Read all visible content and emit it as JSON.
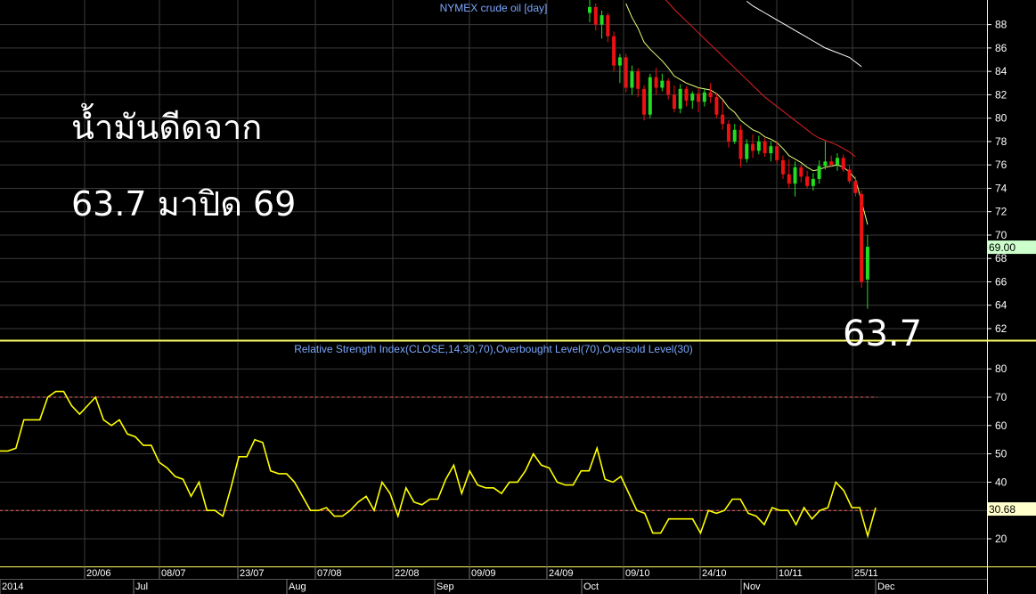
{
  "annotations": {
    "line1": "น้ำมันดีดจาก",
    "line2": "63.7 มาปิด 69",
    "low_label": "63.7"
  },
  "chart_data": [
    {
      "type": "candlestick",
      "title": "NYMEX crude oil [day]",
      "ylim": [
        61,
        90
      ],
      "y_ticks": [
        "62",
        "64",
        "66",
        "68",
        "70",
        "72",
        "74",
        "76",
        "78",
        "80",
        "82",
        "84",
        "86",
        "88"
      ],
      "last_value_label": "69.00",
      "last_value": 69.0,
      "series": [
        {
          "kind": "ohlc",
          "points": [
            [
              89.0,
              90.5,
              88.2,
              89.5
            ],
            [
              89.5,
              89.8,
              87.5,
              88.0
            ],
            [
              88.0,
              89.2,
              86.8,
              88.8
            ],
            [
              88.8,
              89.0,
              86.5,
              87.0
            ],
            [
              87.0,
              87.4,
              84.0,
              84.5
            ],
            [
              84.5,
              85.5,
              83.0,
              85.2
            ],
            [
              85.2,
              85.5,
              82.2,
              82.6
            ],
            [
              82.6,
              84.5,
              82.0,
              84.0
            ],
            [
              84.0,
              84.3,
              81.8,
              82.5
            ],
            [
              82.5,
              82.8,
              79.8,
              80.3
            ],
            [
              80.3,
              83.8,
              80.0,
              83.5
            ],
            [
              83.5,
              84.3,
              82.0,
              82.6
            ],
            [
              82.6,
              83.8,
              82.3,
              83.2
            ],
            [
              83.2,
              83.4,
              81.6,
              82.0
            ],
            [
              82.0,
              82.8,
              80.5,
              80.8
            ],
            [
              80.8,
              82.9,
              80.4,
              82.5
            ],
            [
              82.5,
              82.7,
              81.0,
              81.5
            ],
            [
              81.5,
              82.3,
              80.8,
              82.1
            ],
            [
              82.1,
              82.6,
              80.5,
              81.4
            ],
            [
              81.4,
              82.5,
              81.0,
              82.2
            ],
            [
              82.2,
              83.0,
              81.3,
              81.8
            ],
            [
              81.8,
              82.1,
              80.0,
              80.3
            ],
            [
              80.3,
              81.5,
              79.0,
              79.5
            ],
            [
              79.5,
              79.8,
              77.5,
              78.0
            ],
            [
              78.0,
              79.5,
              77.8,
              79.0
            ],
            [
              79.0,
              79.4,
              75.8,
              76.5
            ],
            [
              76.5,
              78.2,
              76.2,
              77.8
            ],
            [
              77.8,
              78.6,
              76.6,
              77.2
            ],
            [
              77.2,
              78.5,
              76.9,
              78.0
            ],
            [
              78.0,
              78.3,
              76.7,
              77.0
            ],
            [
              77.0,
              78.0,
              76.3,
              77.6
            ],
            [
              77.6,
              78.0,
              76.1,
              76.4
            ],
            [
              76.4,
              76.8,
              74.8,
              75.2
            ],
            [
              75.2,
              76.5,
              74.0,
              74.4
            ],
            [
              74.4,
              76.3,
              73.3,
              75.8
            ],
            [
              75.8,
              76.0,
              74.5,
              75.0
            ],
            [
              75.0,
              75.5,
              74.0,
              74.2
            ],
            [
              74.2,
              75.3,
              73.8,
              74.8
            ],
            [
              74.8,
              76.4,
              74.4,
              75.9
            ],
            [
              75.9,
              78.0,
              75.6,
              76.3
            ],
            [
              76.3,
              76.8,
              75.8,
              76.0
            ],
            [
              76.0,
              77.0,
              75.5,
              76.6
            ],
            [
              76.6,
              76.9,
              75.4,
              75.6
            ],
            [
              75.6,
              76.0,
              74.4,
              74.6
            ],
            [
              74.6,
              75.0,
              73.3,
              73.6
            ],
            [
              73.5,
              73.8,
              65.5,
              66.0
            ],
            [
              66.2,
              70.0,
              63.7,
              69.0
            ]
          ]
        },
        {
          "kind": "line",
          "name": "",
          "color": "#e8ff7a",
          "values": [
            null,
            null,
            null,
            null,
            null,
            null,
            89.8,
            88.6,
            87.7,
            86.5,
            85.9,
            85.4,
            84.9,
            84.3,
            83.6,
            83.3,
            83.0,
            82.8,
            82.6,
            82.5,
            82.4,
            82.1,
            81.6,
            80.9,
            80.5,
            79.8,
            79.4,
            79.0,
            78.8,
            78.4,
            78.2,
            77.9,
            77.4,
            76.8,
            76.5,
            76.2,
            75.8,
            75.5,
            75.6,
            75.8,
            75.9,
            76.0,
            75.8,
            75.4,
            74.8,
            72.9,
            70.9
          ]
        },
        {
          "kind": "line",
          "name": "",
          "color": "#e02020",
          "values": [
            null,
            null,
            null,
            null,
            null,
            null,
            null,
            null,
            null,
            null,
            null,
            null,
            90.4,
            89.9,
            89.3,
            88.8,
            88.3,
            87.8,
            87.3,
            86.8,
            86.3,
            85.8,
            85.3,
            84.8,
            84.3,
            83.8,
            83.3,
            82.8,
            82.3,
            81.8,
            81.4,
            81.0,
            80.6,
            80.2,
            79.8,
            79.4,
            79.0,
            78.6,
            78.3,
            78.1,
            77.9,
            77.7,
            77.4,
            77.1,
            76.7
          ]
        },
        {
          "kind": "line",
          "name": "",
          "color": "#ffffff",
          "values": [
            null,
            null,
            null,
            null,
            null,
            null,
            null,
            null,
            null,
            null,
            null,
            null,
            null,
            null,
            null,
            null,
            null,
            null,
            null,
            null,
            null,
            null,
            null,
            null,
            null,
            null,
            90.0,
            89.6,
            89.3,
            89.0,
            88.7,
            88.4,
            88.1,
            87.8,
            87.5,
            87.2,
            86.9,
            86.6,
            86.3,
            86.0,
            85.8,
            85.6,
            85.4,
            85.2,
            84.8,
            84.4
          ]
        }
      ]
    },
    {
      "type": "line",
      "title": "Relative Strength Index(CLOSE,14,30,70),Overbought Level(70),Oversold Level(30)",
      "ylim": [
        15,
        86
      ],
      "y_ticks": [
        "20",
        "30",
        "40",
        "50",
        "60",
        "70",
        "80"
      ],
      "reference_lines": [
        70,
        30
      ],
      "last_value_label": "30.68",
      "last_value": 30.68,
      "color": "#ffff00",
      "values": [
        51,
        51,
        52,
        62,
        62,
        62,
        70,
        72,
        72,
        67,
        64,
        67,
        70,
        62,
        60,
        62,
        57,
        56,
        53,
        53,
        47,
        45,
        42,
        41,
        35,
        40,
        30,
        30,
        28,
        38,
        49,
        49,
        55,
        54,
        44,
        43,
        43,
        40,
        35,
        30,
        30,
        31,
        28,
        28,
        30,
        33,
        35,
        30,
        40,
        36,
        28,
        38,
        33,
        32,
        34,
        34,
        41,
        46,
        36,
        44,
        39,
        38,
        38,
        36,
        40,
        40,
        44,
        50,
        46,
        45,
        40,
        39,
        39,
        44,
        44,
        52,
        41,
        40,
        42,
        36,
        30,
        29,
        22,
        22,
        27,
        27,
        27,
        27,
        22,
        30,
        29,
        30,
        34,
        34,
        29,
        28,
        25,
        31,
        30,
        30,
        25,
        31,
        27,
        30,
        31,
        40,
        37,
        31,
        31,
        21,
        31
      ]
    }
  ],
  "x_axis": {
    "date_labels": [
      "20/06",
      "08/07",
      "23/07",
      "07/08",
      "22/08",
      "09/09",
      "24/09",
      "09/10",
      "24/10",
      "10/11",
      "25/11"
    ],
    "month_labels": [
      "2014",
      "Jul",
      "Aug",
      "Sep",
      "Oct",
      "Nov",
      "Dec"
    ]
  },
  "colors": {
    "background": "#000000",
    "grid": "#3a3a3a",
    "frame": "#ffff66",
    "up_candle": "#22dd22",
    "down_candle": "#ee1111",
    "title_text": "#7aa7ff",
    "axis_text": "#ffffff",
    "price_tag": "#ccffcc",
    "rsi_tag": "#ffffcc",
    "ref_line": "#ff6060"
  }
}
